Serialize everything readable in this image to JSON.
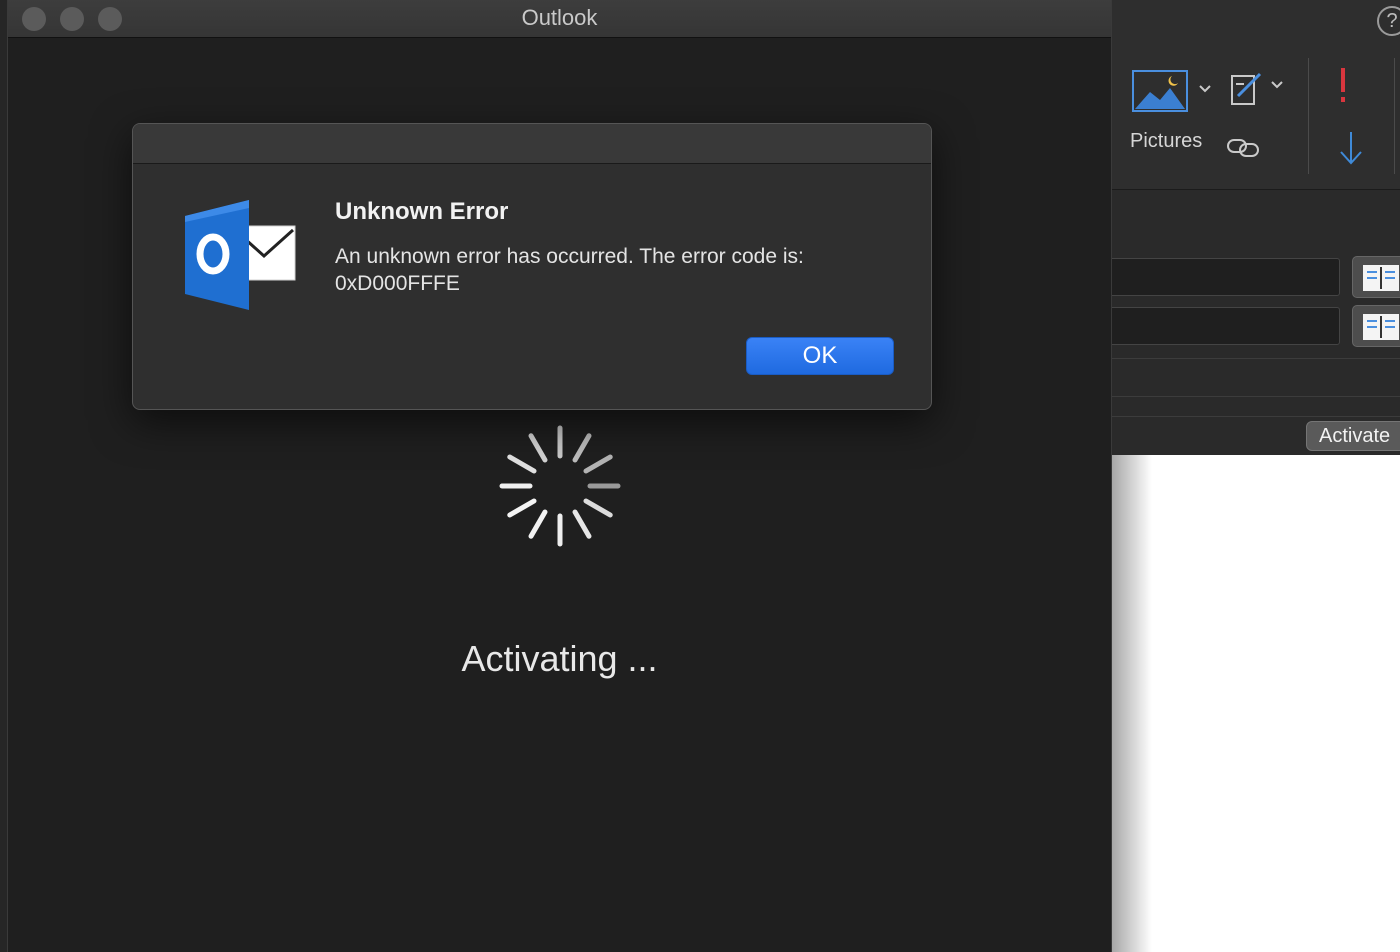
{
  "window": {
    "title": "Outlook"
  },
  "background_window": {
    "ribbon": {
      "pictures_label": "Pictures",
      "help_icon": "question-icon"
    },
    "activate_button_label": "Activate"
  },
  "main": {
    "status_label": "Activating ..."
  },
  "dialog": {
    "title": "Unknown Error",
    "message": "An unknown error has occurred. The error code is: 0xD000FFFE",
    "ok_label": "OK",
    "app_icon": "outlook-icon"
  },
  "colors": {
    "accent_blue": "#2a77ee",
    "priority_high": "#d9363e",
    "priority_low": "#3f8ad8",
    "outlook_blue": "#1f6fd1"
  }
}
